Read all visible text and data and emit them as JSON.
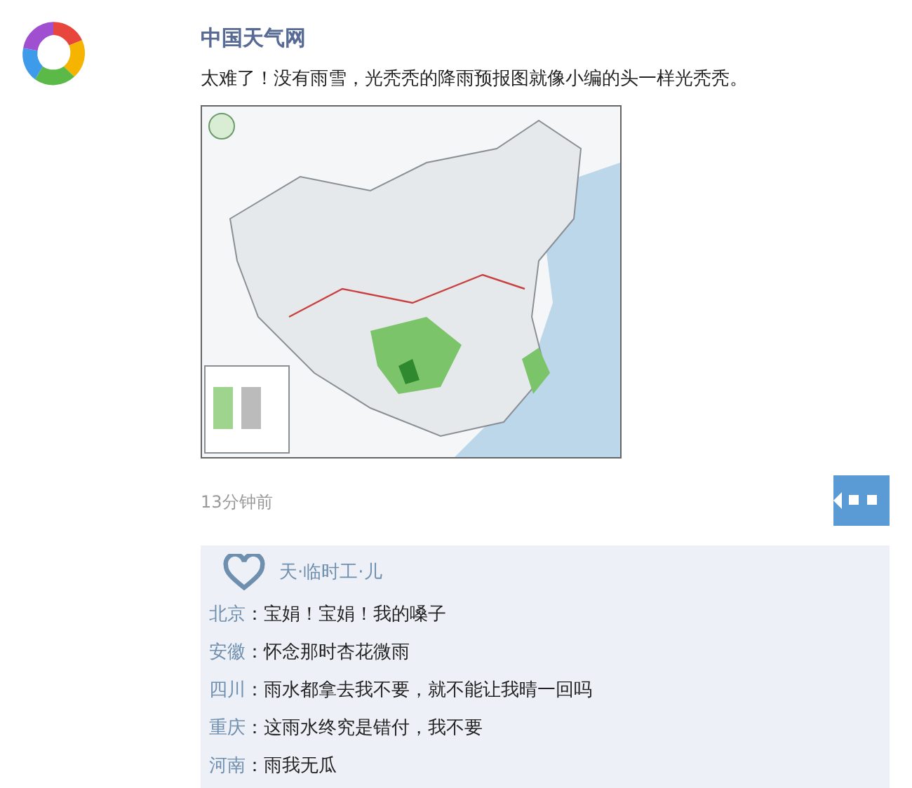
{
  "post": {
    "author": "中国天气网",
    "text": "太难了！没有雨雪，光秃秃的降雨预报图就像小编的头一样光秃秃。",
    "time": "13分钟前"
  },
  "likes": {
    "names": "天·临时工·儿"
  },
  "comments": [
    {
      "author": "北京",
      "text": "：宝娟！宝娟！我的嗓子"
    },
    {
      "author": "安徽",
      "text": "：怀念那时杏花微雨"
    },
    {
      "author": "四川",
      "text": "：雨水都拿去我不要，就不能让我晴一回吗"
    },
    {
      "author": "重庆",
      "text": "：这雨水终究是错付，我不要"
    },
    {
      "author": "河南",
      "text": "：雨我无瓜"
    }
  ]
}
